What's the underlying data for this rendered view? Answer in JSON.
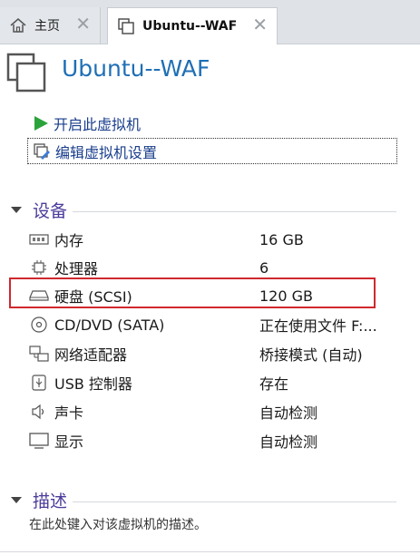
{
  "tabs": {
    "home": {
      "label": "主页",
      "icon": "home-icon"
    },
    "vm": {
      "label": "Ubuntu--WAF",
      "icon": "vm-icon"
    },
    "close_glyph": "✕"
  },
  "header": {
    "title": "Ubuntu--WAF",
    "icon": "vm-icon"
  },
  "actions": {
    "start": {
      "label": "开启此虚拟机",
      "icon": "play-icon"
    },
    "edit": {
      "label": "编辑虚拟机设置",
      "icon": "edit-settings-icon"
    }
  },
  "devices": {
    "title": "设备",
    "items": [
      {
        "name": "内存",
        "value": "16 GB",
        "icon": "memory-icon"
      },
      {
        "name": "处理器",
        "value": "6",
        "icon": "cpu-icon"
      },
      {
        "name": "硬盘 (SCSI)",
        "value": "120 GB",
        "icon": "hard-disk-icon"
      },
      {
        "name": "CD/DVD (SATA)",
        "value": "正在使用文件 F:...",
        "icon": "cd-dvd-icon"
      },
      {
        "name": "网络适配器",
        "value": "桥接模式 (自动)",
        "icon": "network-adapter-icon"
      },
      {
        "name": "USB 控制器",
        "value": "存在",
        "icon": "usb-icon"
      },
      {
        "name": "声卡",
        "value": "自动检测",
        "icon": "sound-card-icon"
      },
      {
        "name": "显示",
        "value": "自动检测",
        "icon": "display-icon"
      }
    ]
  },
  "description": {
    "title": "描述",
    "placeholder": "在此处键入对该虚拟机的描述。"
  },
  "colors": {
    "title_blue": "#1f6fb5",
    "section_purple": "#4b3c9b",
    "highlight_red": "#d0282e",
    "play_green": "#2aa43a"
  }
}
